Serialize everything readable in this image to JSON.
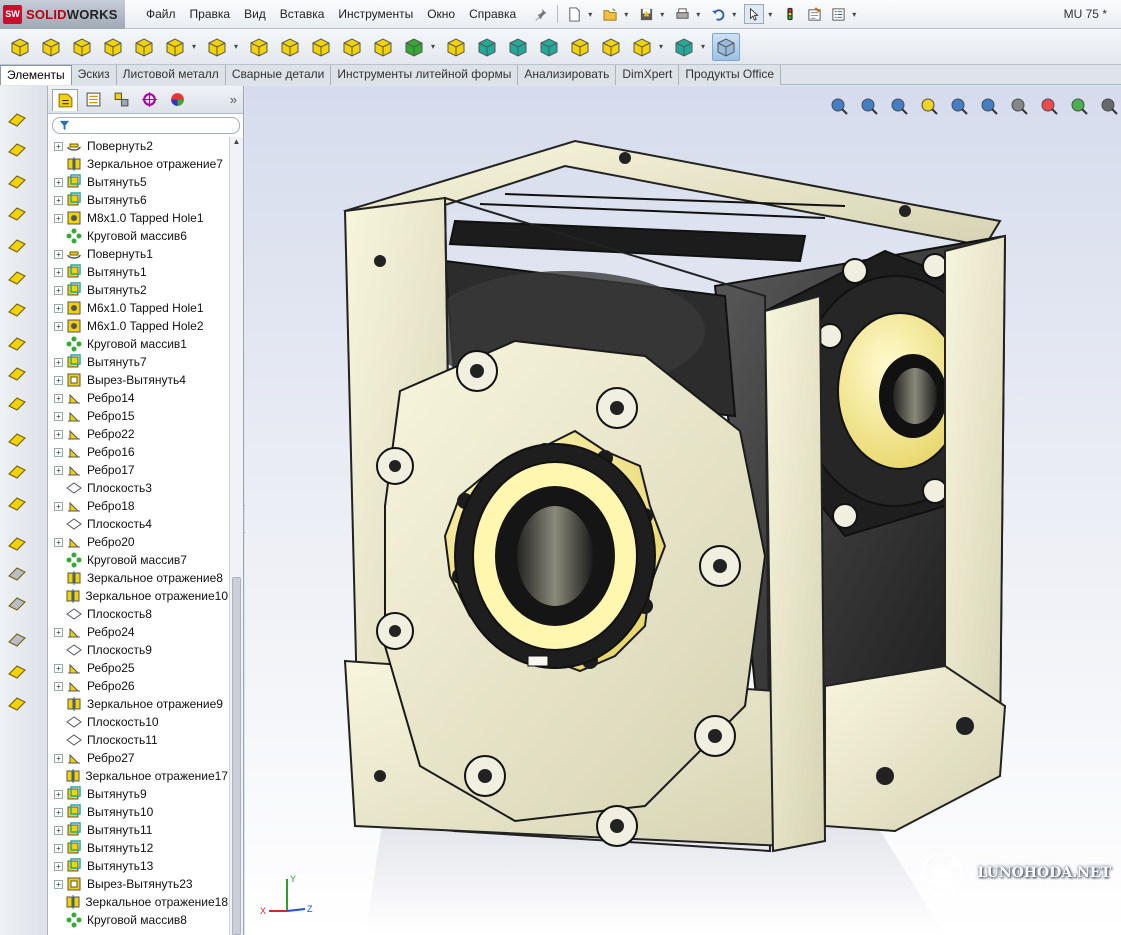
{
  "app": {
    "logo_badge": "SW",
    "logo_brand_red": "SOLID",
    "logo_brand_dark": "WORKS",
    "document_title": "MU 75 *"
  },
  "menu": {
    "items": [
      "Файл",
      "Правка",
      "Вид",
      "Вставка",
      "Инструменты",
      "Окно",
      "Справка"
    ]
  },
  "quick_access": {
    "icons": [
      "pin-icon",
      "new-document-icon",
      "open-icon",
      "save-icon",
      "print-icon",
      "undo-icon",
      "select-arrow-icon",
      "rebuild-icon",
      "file-properties-icon",
      "options-icon"
    ]
  },
  "command_manager": {
    "icons": [
      "extruded-boss-icon",
      "revolved-boss-icon",
      "swept-boss-icon",
      "lofted-boss-icon",
      "boundary-boss-icon",
      "extruded-cut-icon",
      "hole-wizard-icon",
      "revolved-cut-icon",
      "swept-cut-icon",
      "lofted-cut-icon",
      "boundary-cut-icon",
      "fillet-icon",
      "linear-pattern-icon",
      "rib-icon",
      "draft-icon",
      "shell-icon",
      "wrap-icon",
      "dome-icon",
      "mirror-icon",
      "reference-geometry-icon",
      "curves-icon",
      "instant3d-icon"
    ]
  },
  "tabs": [
    "Элементы",
    "Эскиз",
    "Листовой металл",
    "Сварные детали",
    "Инструменты литейной формы",
    "Анализировать",
    "DimXpert",
    "Продукты Office"
  ],
  "panel_tabs": [
    "feature-manager-tab-icon",
    "property-manager-tab-icon",
    "configuration-manager-tab-icon",
    "dimxpert-manager-tab-icon",
    "display-manager-tab-icon"
  ],
  "tree": {
    "filter_icon": "filter-icon",
    "items": [
      {
        "label": "Повернуть2",
        "type": "revolve",
        "expandable": true
      },
      {
        "label": "Зеркальное отражение7",
        "type": "mirror",
        "expandable": false
      },
      {
        "label": "Вытянуть5",
        "type": "extrude",
        "expandable": true
      },
      {
        "label": "Вытянуть6",
        "type": "extrude",
        "expandable": true
      },
      {
        "label": "M8x1.0 Tapped Hole1",
        "type": "hole",
        "expandable": true
      },
      {
        "label": "Круговой массив6",
        "type": "pattern",
        "expandable": false
      },
      {
        "label": "Повернуть1",
        "type": "revolve",
        "expandable": true
      },
      {
        "label": "Вытянуть1",
        "type": "extrude",
        "expandable": true
      },
      {
        "label": "Вытянуть2",
        "type": "extrude",
        "expandable": true
      },
      {
        "label": "M6x1.0 Tapped Hole1",
        "type": "hole",
        "expandable": true
      },
      {
        "label": "M6x1.0 Tapped Hole2",
        "type": "hole",
        "expandable": true
      },
      {
        "label": "Круговой массив1",
        "type": "pattern",
        "expandable": false
      },
      {
        "label": "Вытянуть7",
        "type": "extrude",
        "expandable": true
      },
      {
        "label": "Вырез-Вытянуть4",
        "type": "cut",
        "expandable": true
      },
      {
        "label": "Ребро14",
        "type": "rib",
        "expandable": true
      },
      {
        "label": "Ребро15",
        "type": "rib",
        "expandable": true
      },
      {
        "label": "Ребро22",
        "type": "rib",
        "expandable": true
      },
      {
        "label": "Ребро16",
        "type": "rib",
        "expandable": true
      },
      {
        "label": "Ребро17",
        "type": "rib",
        "expandable": true
      },
      {
        "label": "Плоскость3",
        "type": "plane",
        "expandable": false
      },
      {
        "label": "Ребро18",
        "type": "rib",
        "expandable": true
      },
      {
        "label": "Плоскость4",
        "type": "plane",
        "expandable": false
      },
      {
        "label": "Ребро20",
        "type": "rib",
        "expandable": true
      },
      {
        "label": "Круговой массив7",
        "type": "pattern",
        "expandable": false
      },
      {
        "label": "Зеркальное отражение8",
        "type": "mirror",
        "expandable": false
      },
      {
        "label": "Зеркальное отражение10",
        "type": "mirror",
        "expandable": false
      },
      {
        "label": "Плоскость8",
        "type": "plane",
        "expandable": false
      },
      {
        "label": "Ребро24",
        "type": "rib",
        "expandable": true
      },
      {
        "label": "Плоскость9",
        "type": "plane",
        "expandable": false
      },
      {
        "label": "Ребро25",
        "type": "rib",
        "expandable": true
      },
      {
        "label": "Ребро26",
        "type": "rib",
        "expandable": true
      },
      {
        "label": "Зеркальное отражение9",
        "type": "mirror",
        "expandable": false
      },
      {
        "label": "Плоскость10",
        "type": "plane",
        "expandable": false
      },
      {
        "label": "Плоскость11",
        "type": "plane",
        "expandable": false
      },
      {
        "label": "Ребро27",
        "type": "rib",
        "expandable": true
      },
      {
        "label": "Зеркальное отражение17",
        "type": "mirror",
        "expandable": false
      },
      {
        "label": "Вытянуть9",
        "type": "extrude",
        "expandable": true
      },
      {
        "label": "Вытянуть10",
        "type": "extrude",
        "expandable": true
      },
      {
        "label": "Вытянуть11",
        "type": "extrude",
        "expandable": true
      },
      {
        "label": "Вытянуть12",
        "type": "extrude",
        "expandable": true
      },
      {
        "label": "Вытянуть13",
        "type": "extrude",
        "expandable": true
      },
      {
        "label": "Вырез-Вытянуть23",
        "type": "cut",
        "expandable": true
      },
      {
        "label": "Зеркальное отражение18",
        "type": "mirror",
        "expandable": false
      },
      {
        "label": "Круговой массив8",
        "type": "pattern",
        "expandable": false
      }
    ]
  },
  "viewport": {
    "heads_up_icons": [
      "zoom-to-fit-icon",
      "zoom-to-area-icon",
      "previous-view-icon",
      "section-view-icon",
      "view-orientation-icon",
      "display-style-icon",
      "hide-show-items-icon",
      "edit-appearance-icon",
      "apply-scene-icon",
      "view-settings-icon"
    ],
    "triad_labels": {
      "x": "X",
      "y": "Y",
      "z": "Z"
    },
    "watermark": "LUNOHODA.NET"
  },
  "colors": {
    "accent_yellow": "#f2d200",
    "model_cream": "#ecead0",
    "model_dark": "#2a2a2a",
    "brand_red": "#c8102e"
  }
}
